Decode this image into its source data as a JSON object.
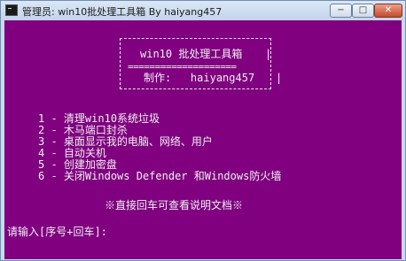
{
  "window": {
    "title": "管理员: win10批处理工具箱  By haiyang457",
    "buttons": {
      "minimize": "−",
      "maximize": "□",
      "close": "✕"
    }
  },
  "banner": {
    "title": "win10 批处理工具箱",
    "separator": "====================",
    "author_label": "制作:",
    "author": "haiyang457",
    "side_bar": "|"
  },
  "menu": {
    "items": [
      {
        "num": "1",
        "label": "清理win10系统垃圾"
      },
      {
        "num": "2",
        "label": "木马端口封杀"
      },
      {
        "num": "3",
        "label": "桌面显示我的电脑、网络、用户"
      },
      {
        "num": "4",
        "label": "自动关机"
      },
      {
        "num": "5",
        "label": "创建加密盘"
      },
      {
        "num": "6",
        "label": "关闭Windows Defender 和Windows防火墙"
      }
    ]
  },
  "hint": "※直接回车可查看说明文档※",
  "prompt": "请输入[序号+回车]:"
}
